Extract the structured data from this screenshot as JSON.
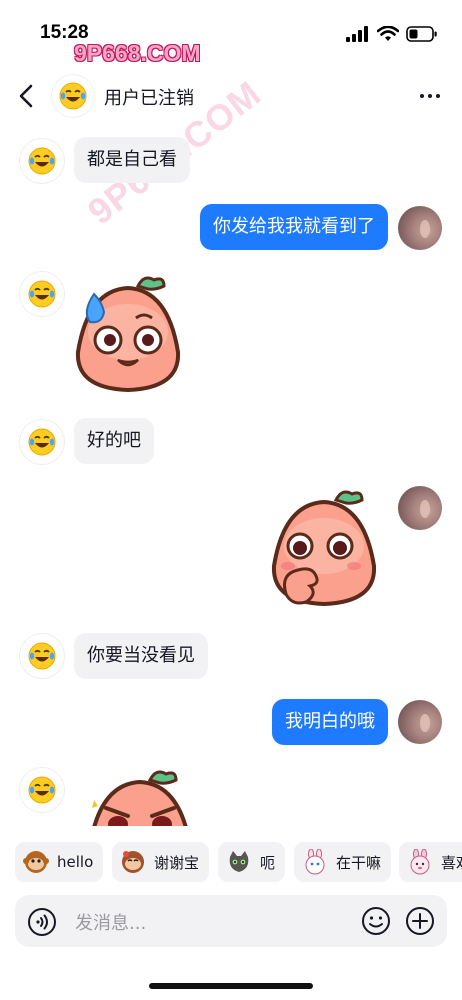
{
  "status_bar": {
    "time": "15:28",
    "watermark": "9P668.COM"
  },
  "header": {
    "title": "用户已注销"
  },
  "diag_watermark": "9P668.COM",
  "messages": [
    {
      "side": "left",
      "text": "都是自己看"
    },
    {
      "side": "right",
      "text": "你发给我我就看到了"
    },
    {
      "side": "left",
      "sticker": "peach-sweat-sticker"
    },
    {
      "side": "left",
      "text": "好的吧"
    },
    {
      "side": "right",
      "sticker": "peach-shy-sticker"
    },
    {
      "side": "left",
      "text": "你要当没看见"
    },
    {
      "side": "right",
      "text": "我明白的哦"
    },
    {
      "side": "left",
      "sticker": "peach-angry-sticker"
    }
  ],
  "quick_replies": [
    {
      "label": "hello",
      "icon": "monkey-icon"
    },
    {
      "label": "谢谢宝",
      "icon": "monkey-thanks-icon"
    },
    {
      "label": "呃",
      "icon": "cat-icon"
    },
    {
      "label": "在干嘛",
      "icon": "bunny-icon"
    },
    {
      "label": "喜欢",
      "icon": "pink-bunny-icon"
    }
  ],
  "input": {
    "placeholder": "发消息..."
  },
  "colors": {
    "accent": "#1e7bff",
    "bubble_gray": "#f2f2f4"
  }
}
